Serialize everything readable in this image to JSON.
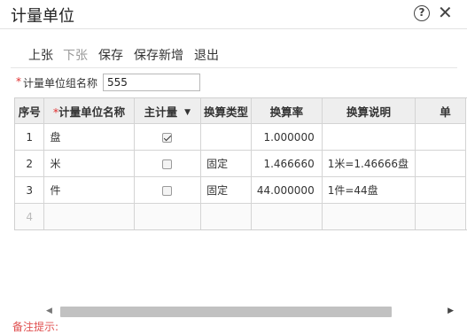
{
  "window": {
    "title": "计量单位",
    "help_glyph": "?",
    "close_glyph": "✕"
  },
  "toolbar": {
    "prev": "上张",
    "next": "下张",
    "save": "保存",
    "save_new": "保存新增",
    "exit": "退出"
  },
  "form": {
    "group_label": "计量单位组名称",
    "required_mark": "*",
    "group_value": "555"
  },
  "table": {
    "columns": {
      "seq": "序号",
      "unit_name": "计量单位名称",
      "main_unit": "主计量",
      "convert_type": "换算类型",
      "convert_rate": "换算率",
      "convert_desc": "换算说明",
      "unit_partial": "单"
    },
    "rows": [
      {
        "seq": "1",
        "name": "盘",
        "main": true,
        "type": "",
        "rate": "1.000000",
        "desc": ""
      },
      {
        "seq": "2",
        "name": "米",
        "main": false,
        "type": "固定",
        "rate": "1.466660",
        "desc": "1米=1.46666盘"
      },
      {
        "seq": "3",
        "name": "件",
        "main": false,
        "type": "固定",
        "rate": "44.000000",
        "desc": "1件=44盘"
      }
    ],
    "empty_row_seq": "4"
  },
  "footer": {
    "remark_partial": "备注提示:"
  }
}
